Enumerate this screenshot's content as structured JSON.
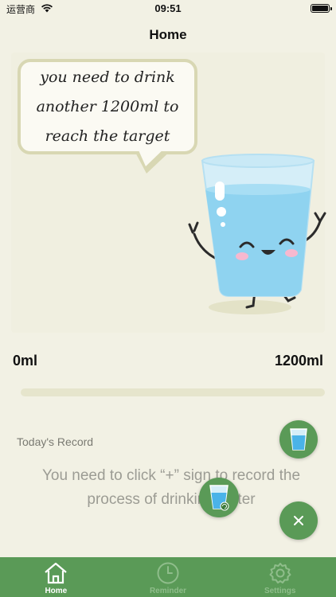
{
  "status_bar": {
    "carrier": "运营商",
    "time": "09:51"
  },
  "nav": {
    "title": "Home"
  },
  "hero": {
    "bubble_text": "you need to drink another 1200ml to reach the target"
  },
  "progress": {
    "min_label": "0ml",
    "max_label": "1200ml",
    "fraction": 0
  },
  "record": {
    "title": "Today's Record",
    "hint": "You need to click “+” sign to record the process of drinking water"
  },
  "tabs": [
    {
      "label": "Home",
      "icon": "house-icon",
      "active": true
    },
    {
      "label": "Reminder",
      "icon": "clock-icon",
      "active": false
    },
    {
      "label": "Settings",
      "icon": "gear-icon",
      "active": false
    }
  ],
  "colors": {
    "background": "#f2f1e4",
    "accent_green": "#5a9a57",
    "bubble_border": "#d8d7b3",
    "water_blue": "#8fd3f0"
  }
}
